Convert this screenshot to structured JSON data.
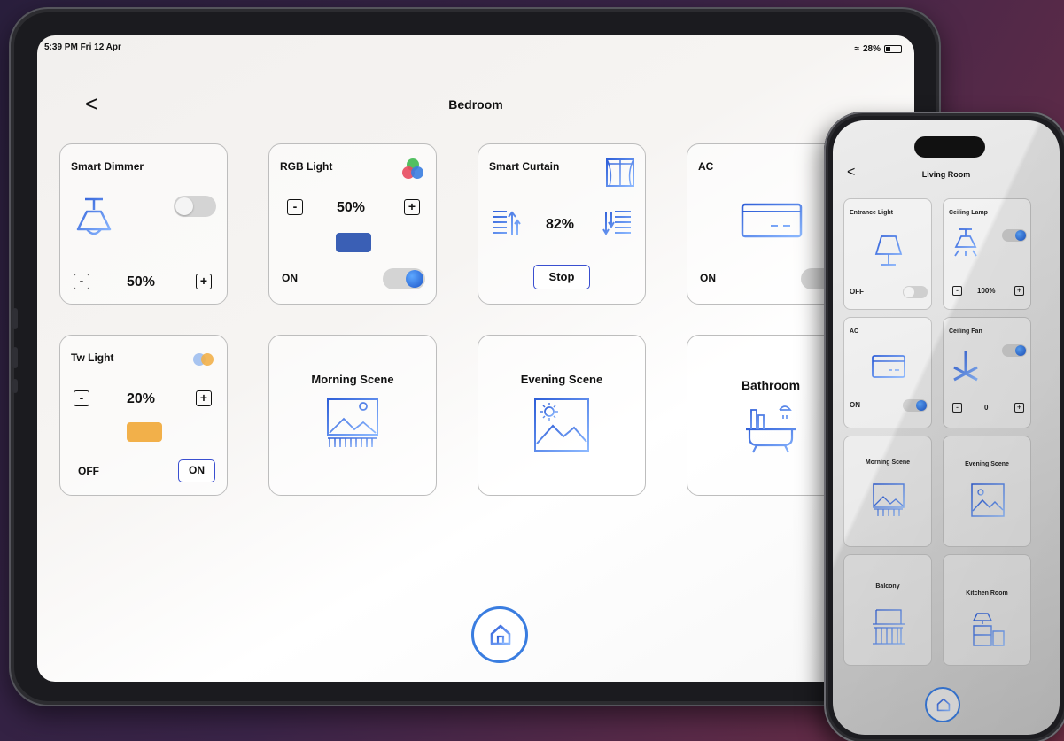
{
  "tablet": {
    "status": {
      "time": "5:39 PM  Fri 12 Apr",
      "battery": "28%"
    },
    "title": "Bedroom",
    "back_label": "<",
    "smart_dimmer": {
      "title": "Smart Dimmer",
      "value": "50%",
      "minus": "-",
      "plus": "+",
      "toggle_on": false
    },
    "rgb_light": {
      "title": "RGB Light",
      "value": "50%",
      "minus": "-",
      "plus": "+",
      "state": "ON",
      "swatch_color": "#3a5fb5",
      "toggle_on": true
    },
    "smart_curtain": {
      "title": "Smart Curtain",
      "value": "82%",
      "stop_label": "Stop"
    },
    "ac": {
      "title": "AC",
      "state": "ON",
      "toggle_on": true
    },
    "tw_light": {
      "title": "Tw Light",
      "value": "20%",
      "minus": "-",
      "plus": "+",
      "off_label": "OFF",
      "on_label": "ON",
      "swatch_color": "#f2b04a"
    },
    "scenes": {
      "morning": "Morning Scene",
      "evening": "Evening Scene",
      "bathroom": "Bathroom"
    }
  },
  "phone": {
    "title": "Living Room",
    "back_label": "<",
    "entrance_light": {
      "title": "Entrance Light",
      "state": "OFF"
    },
    "ceiling_lamp": {
      "title": "Ceiling Lamp",
      "value": "100%",
      "minus": "-",
      "plus": "+"
    },
    "ac": {
      "title": "AC",
      "state": "ON"
    },
    "ceiling_fan": {
      "title": "Ceiling Fan",
      "value": "0",
      "minus": "-",
      "plus": "+"
    },
    "scenes": {
      "morning": "Morning Scene",
      "evening": "Evening Scene",
      "balcony": "Balcony",
      "kitchen": "Kitchen Room"
    }
  },
  "colors": {
    "accent_blue": "#3a7de0",
    "icon_gradient_start": "#3b6fe0",
    "icon_gradient_end": "#7ab0ff"
  }
}
